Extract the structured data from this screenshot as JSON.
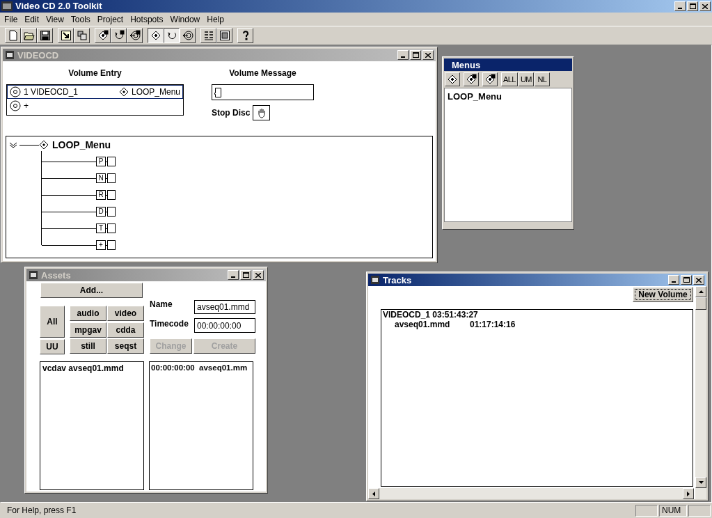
{
  "app": {
    "title": "Video CD 2.0 Toolkit"
  },
  "menu": [
    "File",
    "Edit",
    "View",
    "Tools",
    "Project",
    "Hotspots",
    "Window",
    "Help"
  ],
  "toolbar": [
    [
      {
        "kind": "new",
        "pressed": false
      },
      {
        "kind": "open",
        "pressed": false
      },
      {
        "kind": "save",
        "pressed": false
      }
    ],
    [
      {
        "kind": "import",
        "pressed": false
      },
      {
        "kind": "grid",
        "pressed": false
      }
    ],
    [
      {
        "kind": "diamond-edit",
        "pressed": false
      },
      {
        "kind": "loop-edit",
        "pressed": false
      },
      {
        "kind": "target-edit",
        "pressed": false
      }
    ],
    [
      {
        "kind": "diamond",
        "pressed": true
      },
      {
        "kind": "loop",
        "pressed": true
      },
      {
        "kind": "target",
        "pressed": false
      }
    ],
    [
      {
        "kind": "numbers",
        "pressed": false
      },
      {
        "kind": "frame",
        "pressed": false
      }
    ],
    [
      {
        "kind": "help",
        "pressed": false
      }
    ]
  ],
  "videocd": {
    "title": "VIDEOCD",
    "active": false,
    "volume_entry": {
      "label": "Volume Entry",
      "rows": [
        {
          "name": "1 VIDEOCD_1",
          "menu": "LOOP_Menu",
          "selected": true
        },
        {
          "name": "+",
          "selected": false
        }
      ]
    },
    "volume_message": {
      "label": "Volume Message"
    },
    "stop_disc": {
      "label": "Stop Disc"
    },
    "tree": {
      "root": "LOOP_Menu",
      "children": [
        "P",
        "N",
        "R",
        "D",
        "T",
        "+"
      ]
    }
  },
  "menus": {
    "title": "Menus",
    "active": true,
    "icon_buttons": [
      {
        "kind": "diamond"
      },
      {
        "kind": "diamond-edit"
      },
      {
        "kind": "diamond-plus"
      }
    ],
    "text_buttons": [
      "ALL",
      "UM",
      "NL"
    ],
    "items": [
      "LOOP_Menu"
    ]
  },
  "assets": {
    "title": "Assets",
    "active": false,
    "add": "Add...",
    "filters": {
      "all": "All",
      "uu": "UU",
      "types": [
        "audio",
        "video",
        "mpgav",
        "cdda",
        "still",
        "seqst"
      ]
    },
    "name": {
      "label": "Name",
      "value": "avseq01.mmd"
    },
    "timecode": {
      "label": "Timecode",
      "value": "00:00:00:00"
    },
    "actions": [
      {
        "label": "Change",
        "disabled": true
      },
      {
        "label": "Create",
        "disabled": true
      }
    ],
    "list_left": [
      "vcdav avseq01.mmd"
    ],
    "list_right": [
      "00:00:00:00  avseq01.mm"
    ]
  },
  "tracks": {
    "title": "Tracks",
    "active": true,
    "new_volume": "New Volume",
    "volumes": [
      {
        "name": "VIDEOCD_1 03:51:43:27",
        "tracks": [
          {
            "name": "avseq01.mmd",
            "time": "01:17:14:16"
          }
        ]
      }
    ]
  },
  "status_bar": {
    "text": "For Help, press F1",
    "indicators": [
      "NUM"
    ]
  }
}
